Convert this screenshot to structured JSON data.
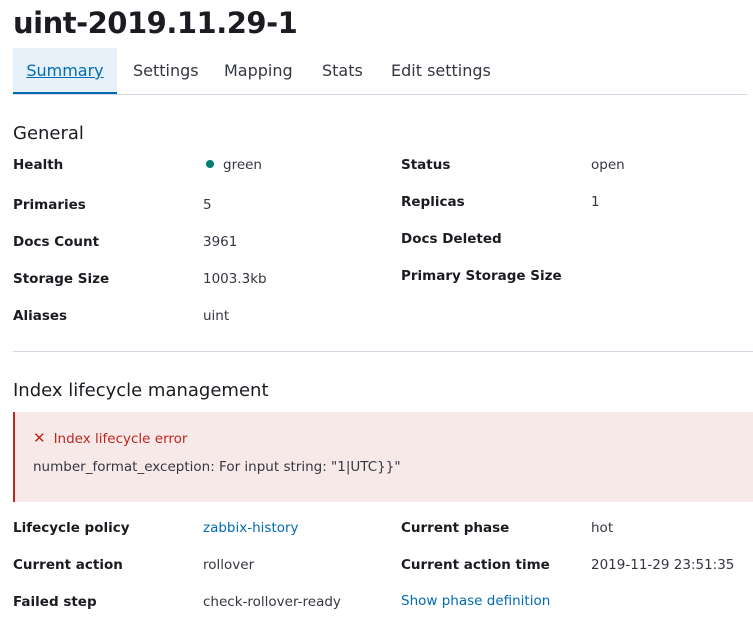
{
  "header": {
    "title": "uint-2019.11.29-1"
  },
  "tabs": [
    {
      "label": "Summary"
    },
    {
      "label": "Settings"
    },
    {
      "label": "Mapping"
    },
    {
      "label": "Stats"
    },
    {
      "label": "Edit settings"
    }
  ],
  "general": {
    "title": "General",
    "health_label": "Health",
    "health_value": "green",
    "status_label": "Status",
    "status_value": "open",
    "primaries_label": "Primaries",
    "primaries_value": "5",
    "replicas_label": "Replicas",
    "replicas_value": "1",
    "docs_count_label": "Docs Count",
    "docs_count_value": "3961",
    "docs_deleted_label": "Docs Deleted",
    "storage_size_label": "Storage Size",
    "storage_size_value": "1003.3kb",
    "primary_storage_size_label": "Primary Storage Size",
    "aliases_label": "Aliases",
    "aliases_value": "uint"
  },
  "ilm": {
    "title": "Index lifecycle management",
    "error_title": "Index lifecycle error",
    "error_message": "number_format_exception: For input string: \"1|UTC}}\"",
    "policy_label": "Lifecycle policy",
    "policy_value": "zabbix-history",
    "phase_label": "Current phase",
    "phase_value": "hot",
    "action_label": "Current action",
    "action_value": "rollover",
    "action_time_label": "Current action time",
    "action_time_value": "2019-11-29 23:51:35",
    "failed_step_label": "Failed step",
    "failed_step_value": "check-rollover-ready",
    "show_phase_link": "Show phase definition"
  },
  "colors": {
    "accent": "#006bb4",
    "health_green": "#017d73",
    "danger": "#bd271e",
    "danger_bg": "#f8e9e9"
  }
}
